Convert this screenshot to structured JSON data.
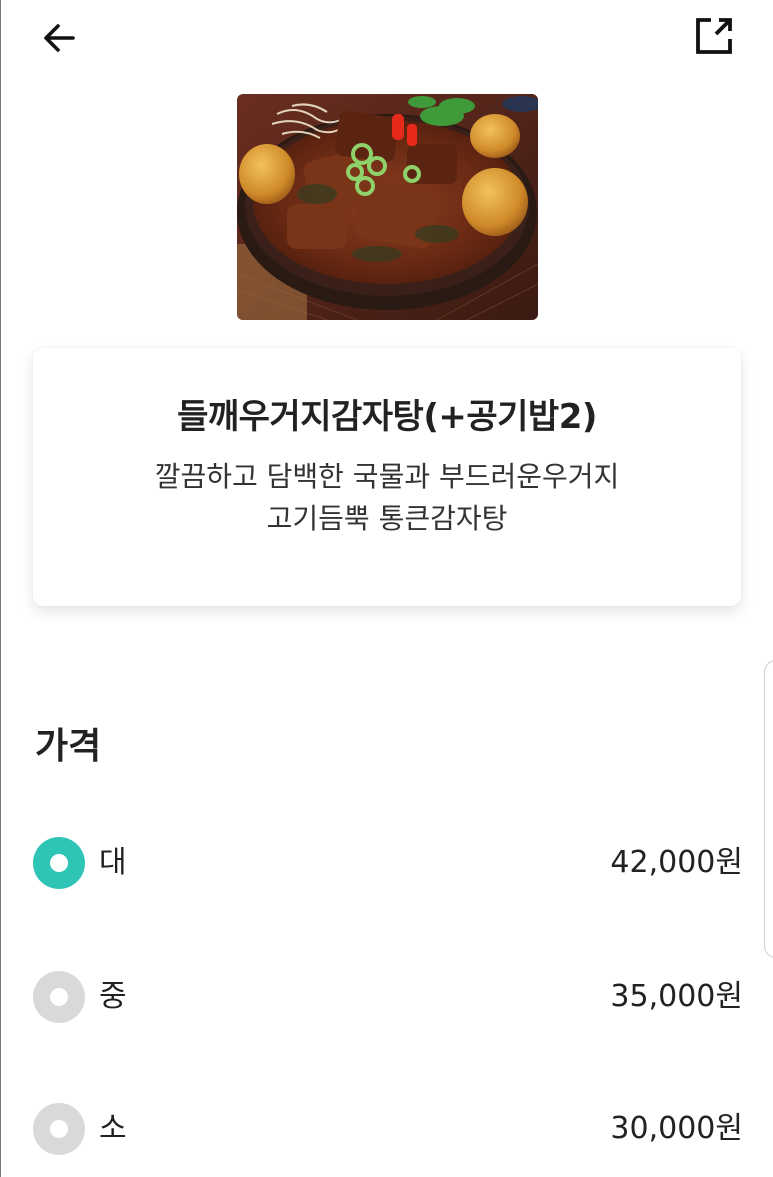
{
  "menu": {
    "title": "들깨우거지감자탕(+공기밥2)",
    "description_lines": [
      "깔끔하고 담백한 국물과 부드러운우거지",
      "고기듬뿍 통큰감자탕"
    ]
  },
  "price_section": {
    "title": "가격",
    "options": [
      {
        "label": "대",
        "price": "42,000원",
        "selected": true
      },
      {
        "label": "중",
        "price": "35,000원",
        "selected": false
      },
      {
        "label": "소",
        "price": "30,000원",
        "selected": false
      }
    ]
  },
  "icons": {
    "back": "arrow-left-icon",
    "share": "share-external-icon"
  },
  "colors": {
    "accent": "#2EC4B6",
    "unselected": "#D9D9D9",
    "text": "#222222"
  }
}
